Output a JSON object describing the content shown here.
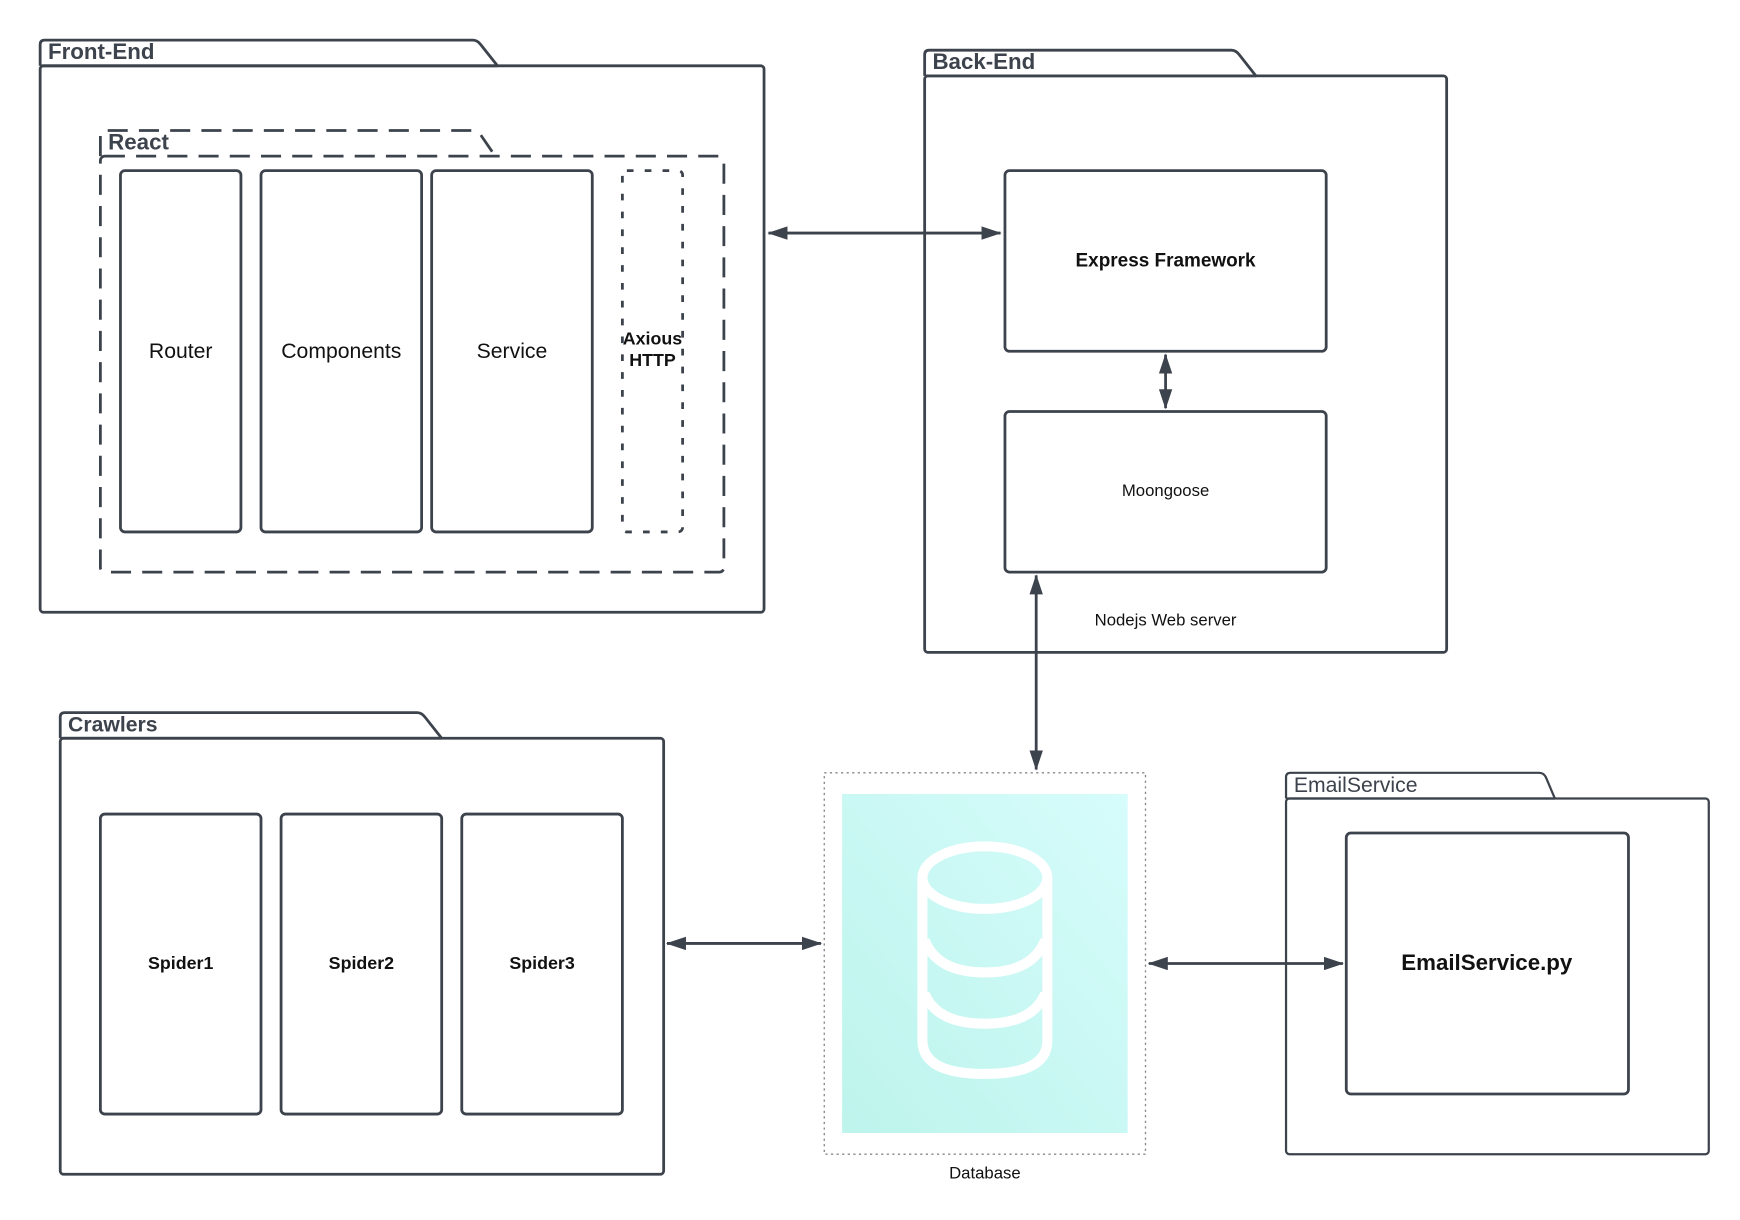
{
  "diagram": {
    "frontend": {
      "title": "Front-End",
      "react": {
        "title": "React",
        "modules": [
          "Router",
          "Components",
          "Service"
        ],
        "axios_line1": "Axious",
        "axios_line2": "HTTP"
      }
    },
    "backend": {
      "title": "Back-End",
      "express": "Express Framework",
      "mongoose": "Moongoose",
      "caption": "Nodejs Web server"
    },
    "crawlers": {
      "title": "Crawlers",
      "spiders": [
        "Spider1",
        "Spider2",
        "Spider3"
      ]
    },
    "database": {
      "caption": "Database",
      "icon": "database-cylinder-icon",
      "fill_top": "#d6fcfb",
      "fill_bottom": "#bdf4ec"
    },
    "email": {
      "title": "EmailService",
      "module": "EmailService.py"
    }
  }
}
